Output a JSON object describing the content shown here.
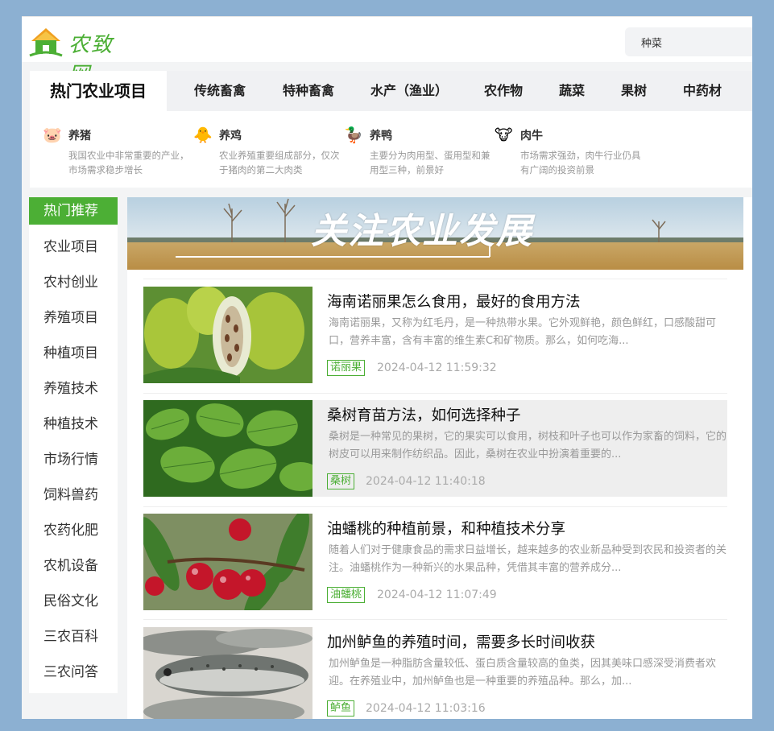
{
  "header": {
    "logo_text": "农致网",
    "search_value": "种菜"
  },
  "category_nav": {
    "active": "热门农业项目",
    "items": [
      "传统畜禽",
      "特种畜禽",
      "水产（渔业）",
      "农作物",
      "蔬菜",
      "果树",
      "中药材"
    ]
  },
  "animals": [
    {
      "icon": "pig-icon",
      "name": "养猪",
      "desc": "我国农业中非常重要的产业，市场需求稳步增长"
    },
    {
      "icon": "chick-icon",
      "name": "养鸡",
      "desc": "农业养殖重要组成部分，仅次于猪肉的第二大肉类"
    },
    {
      "icon": "duck-icon",
      "name": "养鸭",
      "desc": "主要分为肉用型、蛋用型和兼用型三种，前景好"
    },
    {
      "icon": "cow-icon",
      "name": "肉牛",
      "desc": "市场需求强劲，肉牛行业仍具有广阔的投资前景"
    }
  ],
  "sidebar": {
    "items": [
      "热门推荐",
      "农业项目",
      "农村创业",
      "养殖项目",
      "种植项目",
      "养殖技术",
      "种植技术",
      "市场行情",
      "饲料兽药",
      "农药化肥",
      "农机设备",
      "民俗文化",
      "三农百科",
      "三农问答"
    ]
  },
  "banner": {
    "title": "关注农业发展"
  },
  "articles": [
    {
      "title": "海南诺丽果怎么食用，最好的食用方法",
      "summary": "海南诺丽果，又称为红毛丹，是一种热带水果。它外观鲜艳，颜色鲜红，口感酸甜可口，营养丰富，含有丰富的维生素C和矿物质。那么，如何吃海...",
      "tag": "诺丽果",
      "date": "2024-04-12 11:59:32",
      "image": "noni-fruit-image"
    },
    {
      "title": "桑树育苗方法，如何选择种子",
      "summary": "桑树是一种常见的果树，它的果实可以食用，树枝和叶子也可以作为家畜的饲料，它的树皮可以用来制作纺织品。因此，桑树在农业中扮演着重要的...",
      "tag": "桑树",
      "date": "2024-04-12 11:40:18",
      "image": "mulberry-leaves-image"
    },
    {
      "title": "油蟠桃的种植前景，和种植技术分享",
      "summary": "随着人们对于健康食品的需求日益增长，越来越多的农业新品种受到农民和投资者的关注。油蟠桃作为一种新兴的水果品种，凭借其丰富的营养成分...",
      "tag": "油蟠桃",
      "date": "2024-04-12 11:07:49",
      "image": "nectarine-image"
    },
    {
      "title": "加州鲈鱼的养殖时间，需要多长时间收获",
      "summary": "加州鲈鱼是一种脂肪含量较低、蛋白质含量较高的鱼类，因其美味口感深受消费者欢迎。在养殖业中，加州鲈鱼也是一种重要的养殖品种。那么，加...",
      "tag": "鲈鱼",
      "date": "2024-04-12 11:03:16",
      "image": "bass-fish-image"
    }
  ],
  "colors": {
    "accent": "#4caf35",
    "background": "#8cb0d2"
  }
}
